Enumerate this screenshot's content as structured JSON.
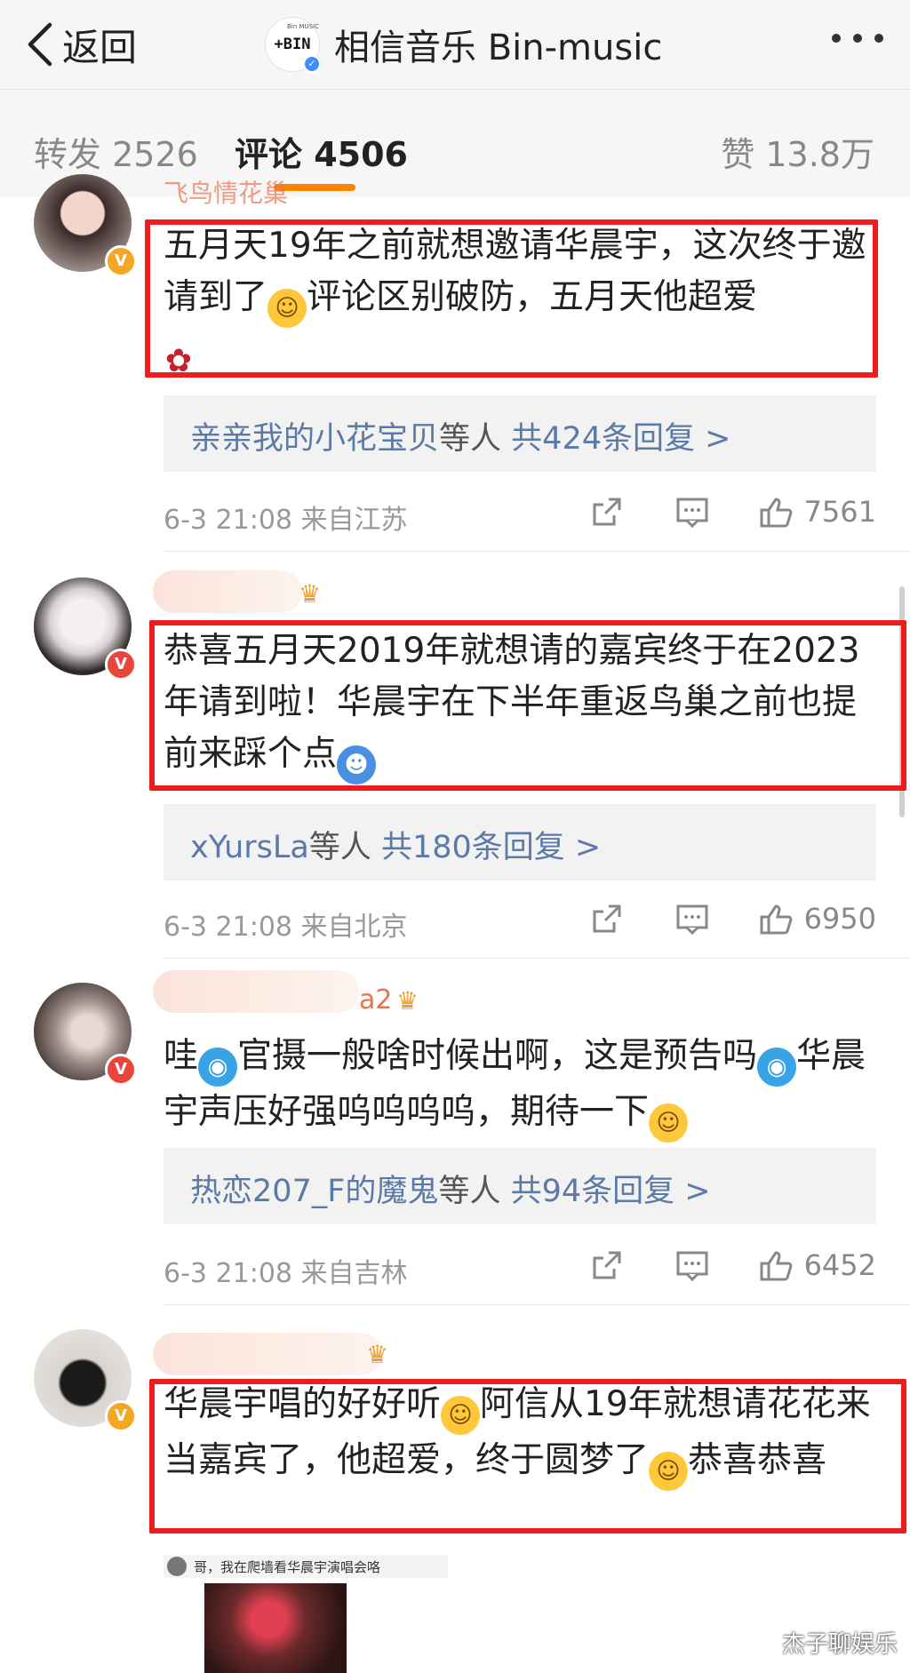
{
  "nav": {
    "back_label": "返回",
    "logo_top": "Bin MUSIC",
    "logo_text": "+BIN",
    "title": "相信音乐 Bin-music"
  },
  "tabs": {
    "repost": "转发 2526",
    "comments": "评论 4506",
    "likes": "赞 13.8万"
  },
  "comments": [
    {
      "username": "飞鸟情花巢",
      "text_parts": [
        "五月天19年之前就想邀请华晨宇，这次终于邀请到了",
        "评论区别破防，五月天他超爱"
      ],
      "reply_names": "亲亲我的小花宝贝",
      "reply_mid": "等人",
      "reply_link": "共424条回复 >",
      "meta": "6-3 21:08 来自江苏",
      "likes": "7561",
      "badge": "V"
    },
    {
      "username": "",
      "text_parts": [
        "恭喜五月天2019年就想请的嘉宾终于在2023年请到啦！华晨宇在下半年重返鸟巢之前也提前来踩个点"
      ],
      "reply_names": "xYursLa",
      "reply_mid": "等人",
      "reply_link": "共180条回复 >",
      "meta": "6-3 21:08 来自北京",
      "likes": "6950",
      "badge": "V"
    },
    {
      "username": "a2",
      "text_parts": [
        "哇",
        "官摄一般啥时候出啊，这是预告吗",
        "华晨宇声压好强呜呜呜呜，期待一下"
      ],
      "reply_names": "热恋207_F的魔鬼",
      "reply_mid": "等人",
      "reply_link": "共94条回复 >",
      "meta": "6-3 21:08 来自吉林",
      "likes": "6452",
      "badge": "V"
    },
    {
      "username": "",
      "text_parts": [
        "华晨宇唱的好好听",
        "阿信从19年就想请花花来当嘉宾了，他超爱，终于圆梦了",
        "恭喜恭喜"
      ],
      "badge": "V"
    }
  ],
  "embedded_preview": {
    "text": "哥，我在爬墙看华晨宇演唱会咯"
  },
  "watermark": "杰子聊娱乐",
  "colors": {
    "accent": "#ff8200",
    "highlight_box": "#ee1c1c",
    "reply_link": "#5b7aa6",
    "username": "#eb7350"
  }
}
